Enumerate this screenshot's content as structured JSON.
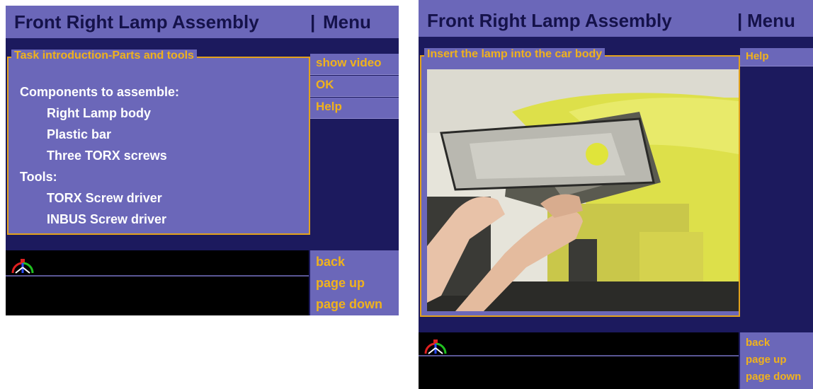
{
  "left_screen": {
    "title": "Front Right Lamp Assembly",
    "separator": "|",
    "menu_label": "Menu",
    "panel_caption": "Task introduction-Parts and tools",
    "menu_items": [
      "show video",
      "OK",
      "Help"
    ],
    "content": {
      "components_heading": "Components to assemble:",
      "components": [
        "Right Lamp body",
        "Plastic bar",
        "Three TORX screws"
      ],
      "tools_heading": "Tools:",
      "tools": [
        "TORX Screw driver",
        "INBUS Screw driver"
      ]
    },
    "nav": {
      "back": "back",
      "page_up": "page up",
      "page_down": "page down"
    }
  },
  "right_screen": {
    "title": "Front Right Lamp Assembly",
    "separator": "|",
    "menu_label": "Menu",
    "panel_caption": "Insert the lamp into the car body",
    "menu_items": [
      "Help"
    ],
    "nav": {
      "back": "back",
      "page_up": "page up",
      "page_down": "page down"
    }
  },
  "colors": {
    "panel": "#6b67b9",
    "background": "#1c1a5e",
    "accent": "#f0b21c",
    "text": "#ffffff"
  }
}
